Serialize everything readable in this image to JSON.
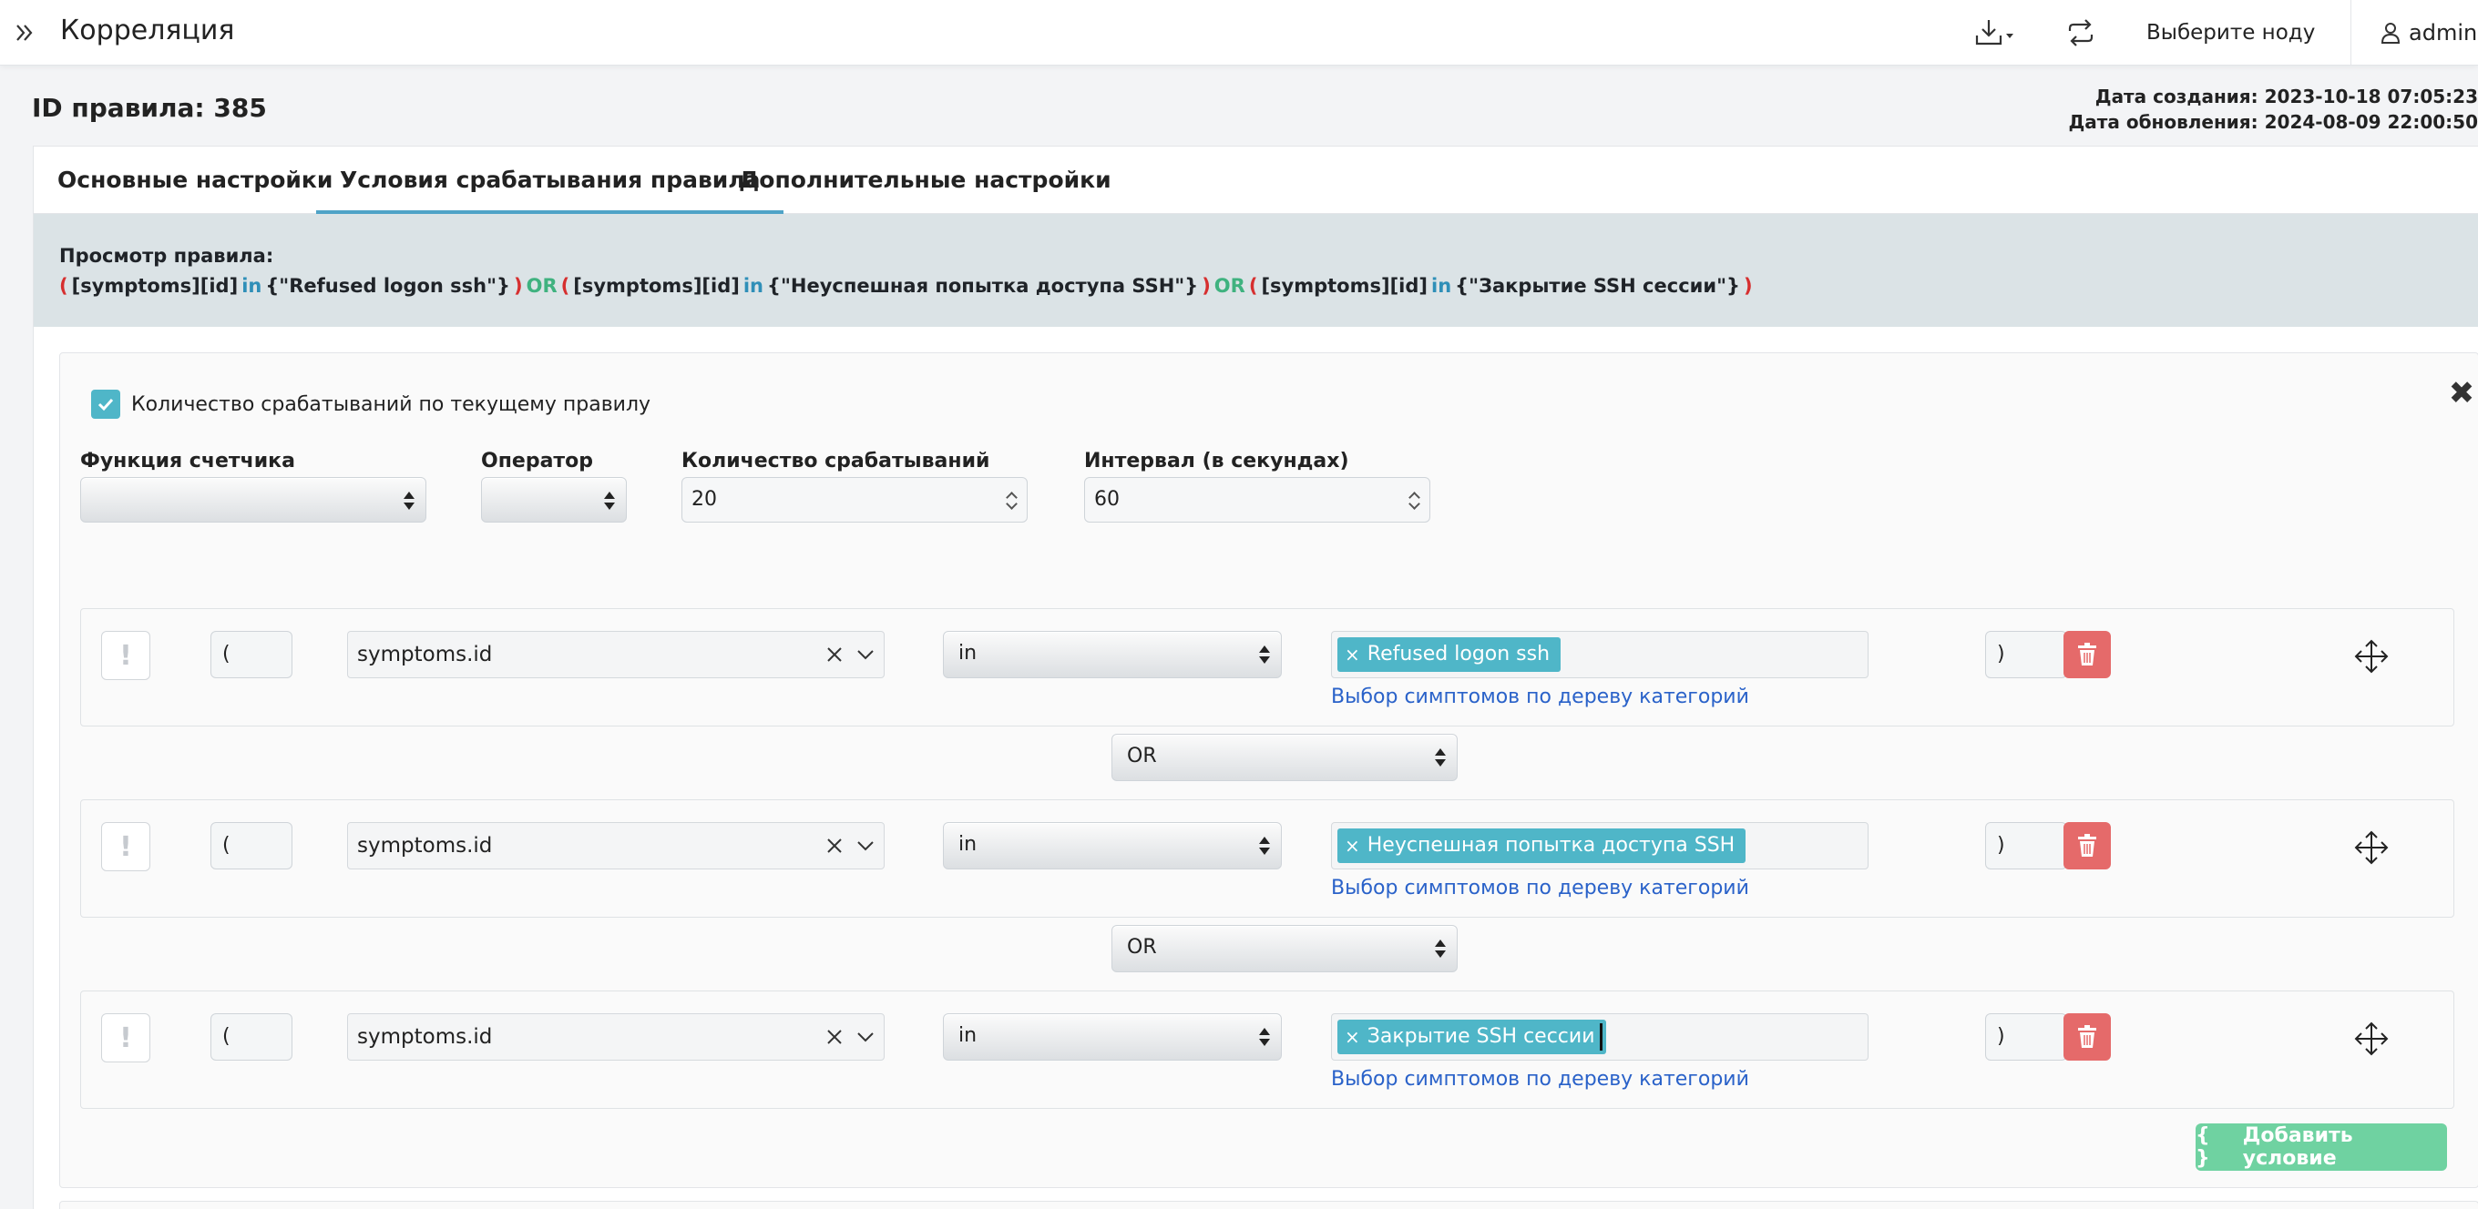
{
  "header": {
    "title": "Корреляция",
    "node_select": "Выберите ноду",
    "user": "admin"
  },
  "rule": {
    "id_label": "ID правила: 385",
    "created": "Дата создания: 2023-10-18 07:05:23",
    "updated": "Дата обновления: 2024-08-09 22:00:50"
  },
  "tabs": [
    {
      "label": "Основные настройки"
    },
    {
      "label": "Условия срабатывания правила",
      "active": true
    },
    {
      "label": "Дополнительные настройки"
    }
  ],
  "preview": {
    "label": "Просмотр правила:",
    "field": "[symptoms][id]",
    "op": "in",
    "logic": "OR",
    "open": "(",
    "close": ")",
    "values": [
      "{\"Refused logon ssh\"}",
      "{\"Неуспешная попытка доступа SSH\"}",
      "{\"Закрытие SSH сессии\"}"
    ]
  },
  "counter": {
    "checkbox_label": "Количество срабатываний по текущему правилу",
    "checked": true,
    "function_label": "Функция счетчика",
    "function_value": "",
    "operator_label": "Оператор",
    "operator_value": "",
    "count_label": "Количество срабатываний",
    "count_value": "20",
    "interval_label": "Интервал (в секундах)",
    "interval_value": "60"
  },
  "conditions": [
    {
      "negate": "!",
      "open": "(",
      "field": "symptoms.id",
      "operator": "in",
      "tag": "Refused logon ssh",
      "link": "Выбор симптомов по дереву категорий",
      "close": ")"
    },
    {
      "negate": "!",
      "open": "(",
      "field": "symptoms.id",
      "operator": "in",
      "tag": "Неуспешная попытка доступа SSH",
      "link": "Выбор симптомов по дереву категорий",
      "close": ")"
    },
    {
      "negate": "!",
      "open": "(",
      "field": "symptoms.id",
      "operator": "in",
      "tag": "Закрытие SSH сессии",
      "link": "Выбор симптомов по дереву категорий",
      "close": ")"
    }
  ],
  "connectors": [
    "OR",
    "OR"
  ],
  "add_condition": {
    "label": "Добавить условие",
    "icon": "{ }"
  },
  "colors": {
    "accent": "#4fb6c8",
    "danger": "#e56a6a",
    "success": "#6fd2a1",
    "link": "#2a62c9"
  }
}
